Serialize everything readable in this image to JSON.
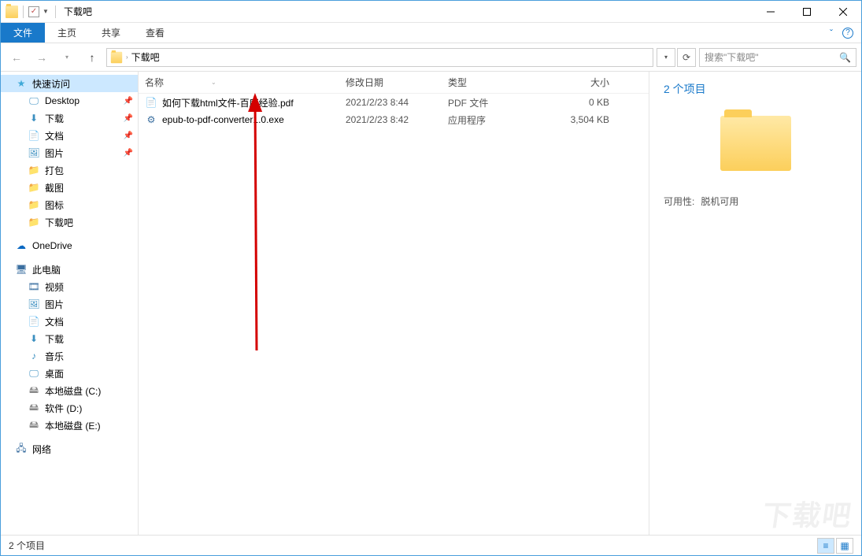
{
  "window": {
    "title": "下载吧"
  },
  "titlebar_qat": {
    "check": "✓"
  },
  "ribbon": {
    "file": "文件",
    "tabs": [
      "主页",
      "共享",
      "查看"
    ]
  },
  "nav": {
    "breadcrumb": "下载吧"
  },
  "search": {
    "placeholder": "搜索\"下载吧\""
  },
  "sidebar": {
    "quick": {
      "label": "快速访问",
      "items": [
        {
          "label": "Desktop",
          "pin": true,
          "icon": "desktop"
        },
        {
          "label": "下载",
          "pin": true,
          "icon": "download"
        },
        {
          "label": "文档",
          "pin": true,
          "icon": "doc"
        },
        {
          "label": "图片",
          "pin": true,
          "icon": "pic"
        },
        {
          "label": "打包",
          "pin": false,
          "icon": "folder"
        },
        {
          "label": "截图",
          "pin": false,
          "icon": "folder"
        },
        {
          "label": "图标",
          "pin": false,
          "icon": "folder"
        },
        {
          "label": "下载吧",
          "pin": false,
          "icon": "folder"
        }
      ]
    },
    "onedrive": "OneDrive",
    "thispc": {
      "label": "此电脑",
      "items": [
        {
          "label": "视频",
          "icon": "video"
        },
        {
          "label": "图片",
          "icon": "pic"
        },
        {
          "label": "文档",
          "icon": "doc"
        },
        {
          "label": "下载",
          "icon": "download"
        },
        {
          "label": "音乐",
          "icon": "music"
        },
        {
          "label": "桌面",
          "icon": "desktop"
        },
        {
          "label": "本地磁盘 (C:)",
          "icon": "disk"
        },
        {
          "label": "软件 (D:)",
          "icon": "disk"
        },
        {
          "label": "本地磁盘 (E:)",
          "icon": "disk"
        }
      ]
    },
    "network": "网络"
  },
  "columns": {
    "name": "名称",
    "date": "修改日期",
    "type": "类型",
    "size": "大小"
  },
  "files": [
    {
      "name": "如何下载html文件-百度经验.pdf",
      "date": "2021/2/23 8:44",
      "type": "PDF 文件",
      "size": "0 KB",
      "icon": "pdf"
    },
    {
      "name": "epub-to-pdf-converter1.0.exe",
      "date": "2021/2/23 8:42",
      "type": "应用程序",
      "size": "3,504 KB",
      "icon": "exe"
    }
  ],
  "preview": {
    "count": "2 个项目",
    "avail_label": "可用性:",
    "avail_value": "脱机可用"
  },
  "status": {
    "text": "2 个项目"
  },
  "watermark": "下载吧"
}
